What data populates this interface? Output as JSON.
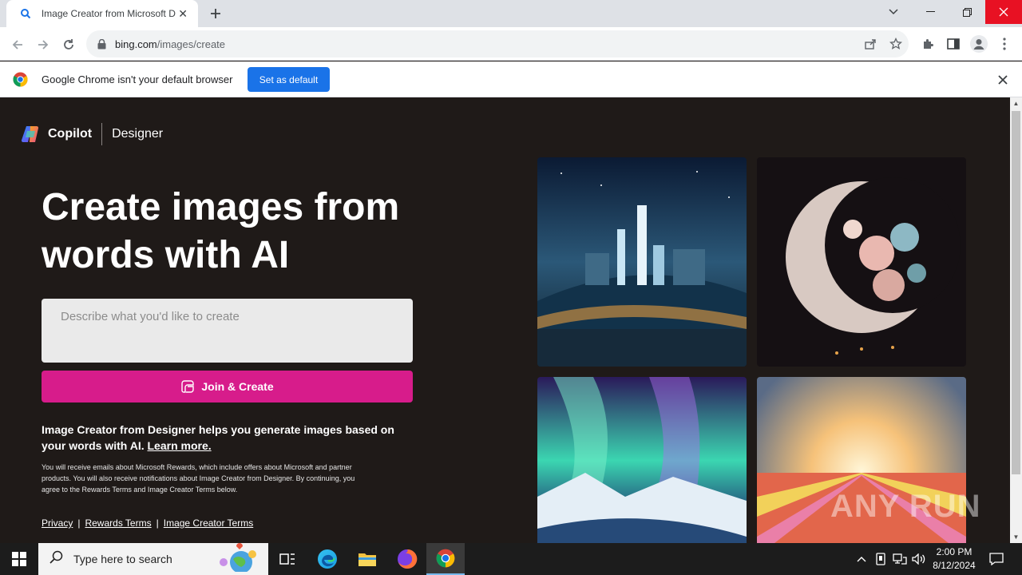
{
  "browser": {
    "tab_title": "Image Creator from Microsoft Designer",
    "url_host": "bing.com",
    "url_path": "/images/create",
    "infobar_message": "Google Chrome isn't your default browser",
    "infobar_button": "Set as default"
  },
  "page": {
    "brand_name": "Copilot",
    "brand_sub": "Designer",
    "hero_line1": "Create images from",
    "hero_line2": "words with AI",
    "prompt_placeholder": "Describe what you'd like to create",
    "join_label": "Join & Create",
    "description": "Image Creator from Designer helps you generate images based on your words with AI.",
    "learn_more": "Learn more.",
    "fine_print": "You will receive emails about Microsoft Rewards, which include offers about Microsoft and partner products. You will also receive notifications about Image Creator from Designer. By continuing, you agree to the Rewards Terms and Image Creator Terms below.",
    "links": [
      "Privacy",
      "Rewards Terms",
      "Image Creator Terms"
    ],
    "link_separator": "|",
    "watermark": "ANY RUN"
  },
  "taskbar": {
    "search_placeholder": "Type here to search",
    "time": "2:00 PM",
    "date": "8/12/2024"
  },
  "colors": {
    "page_bg": "#1f1a18",
    "accent_pink": "#d71c8b",
    "chrome_blue": "#1a73e8"
  }
}
